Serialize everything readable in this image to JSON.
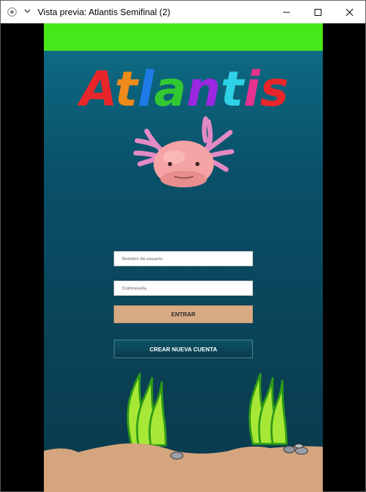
{
  "window": {
    "title": "Vista previa: Atlantis Semifinal (2)",
    "icons": [
      "app-icon",
      "chevron-down-icon",
      "minimize-icon",
      "maximize-icon",
      "close-icon"
    ]
  },
  "app": {
    "brand_title": "Atlantis",
    "username_placeholder": "Nombre de usuario",
    "password_placeholder": "Contraseña",
    "enter_label": "ENTRAR",
    "create_account_label": "CREAR NUEVA CUENTA"
  },
  "colors": {
    "top_bar": "#46e81a",
    "background": "#0a4a5e",
    "enter_button": "#d8aa83",
    "sand": "#d4a57e",
    "seaweed": "#a6e835",
    "logo_letters": [
      "#e8262a",
      "#ef8a1a",
      "#1e7be8",
      "#32c832",
      "#9b27e0",
      "#2fd1e6",
      "#e6318e"
    ]
  }
}
